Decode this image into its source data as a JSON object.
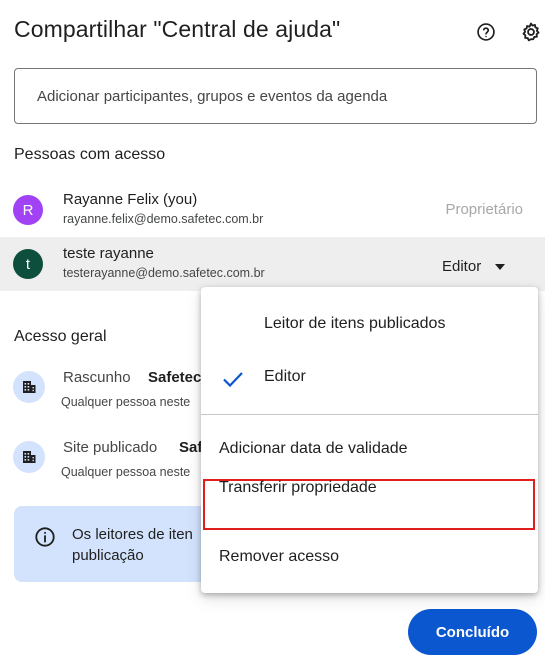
{
  "dialog": {
    "title": "Compartilhar \"Central de ajuda\"",
    "help_icon": "help-circle-icon",
    "settings_icon": "gear-icon"
  },
  "add_input": {
    "placeholder": "Adicionar participantes, grupos e eventos da agenda"
  },
  "people": {
    "heading": "Pessoas com acesso",
    "items": [
      {
        "initial": "R",
        "avatar_color": "#a142f4",
        "name": "Rayanne Felix (you)",
        "email": "rayanne.felix@demo.safetec.com.br",
        "role": "Proprietário"
      },
      {
        "initial": "t",
        "avatar_color": "#0d4f3c",
        "name": "teste rayanne",
        "email": "testerayanne@demo.safetec.com.br",
        "role": "Editor"
      }
    ]
  },
  "general_access": {
    "heading": "Acesso geral",
    "items": [
      {
        "label": "Rascunho",
        "value": "Safetec",
        "sub": "Qualquer pessoa neste",
        "icon": "building-icon"
      },
      {
        "label": "Site publicado",
        "value": "Saf",
        "sub": "Qualquer pessoa neste",
        "icon": "building-icon"
      }
    ]
  },
  "info": {
    "text": "Os leitores de iten publicação",
    "icon": "info-icon"
  },
  "done_label": "Concluído",
  "menu": {
    "reader": "Leitor de itens publicados",
    "editor": "Editor",
    "add_expiry": "Adicionar data de validade",
    "transfer": "Transferir propriedade",
    "remove": "Remover acesso"
  },
  "colors": {
    "accent": "#0b57d0",
    "highlight": "#e01e1e",
    "info_bg": "#d3e3fd"
  }
}
